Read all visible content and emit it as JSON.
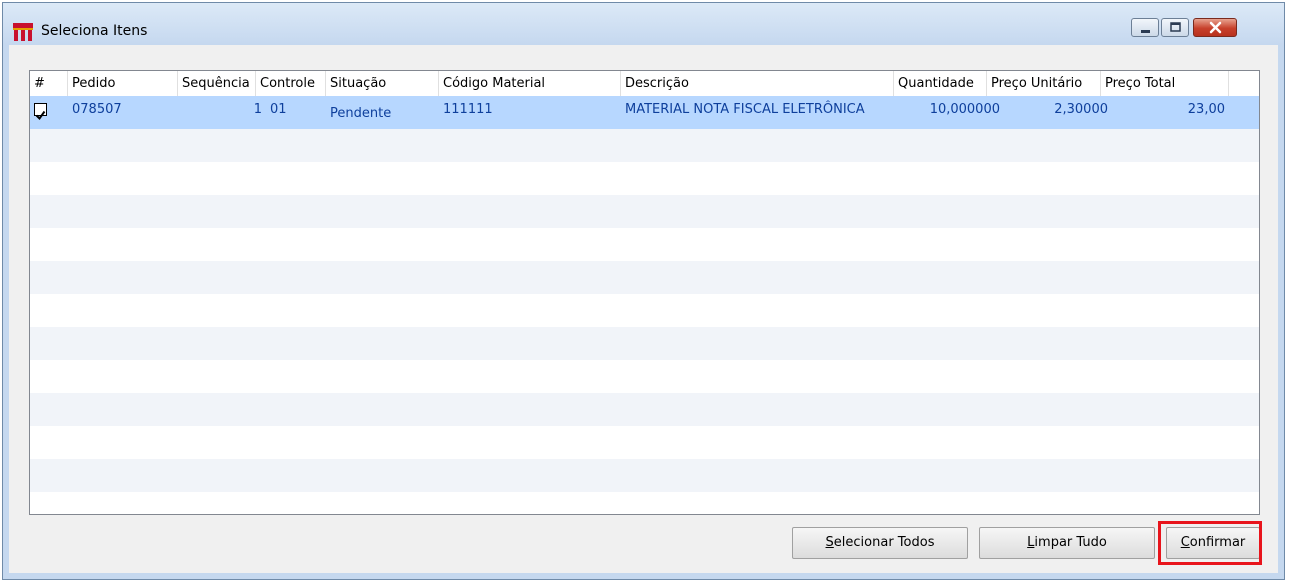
{
  "window": {
    "title": "Seleciona Itens",
    "icon": "app-logo-icon",
    "controls": [
      "minimize-icon",
      "maximize-icon",
      "close-icon"
    ]
  },
  "table": {
    "columns": [
      "#",
      "Pedido",
      "Sequência",
      "Controle",
      "Situação",
      "Código Material",
      "Descrição",
      "Quantidade",
      "Preço Unitário",
      "Preço Total"
    ],
    "rows": [
      {
        "checked": true,
        "pedido": "078507",
        "sequencia": "1",
        "controle": "01",
        "situacao": "Pendente",
        "codigo_material": "111111",
        "descricao": "MATERIAL NOTA FISCAL ELETRÔNICA",
        "quantidade": "10,000000",
        "preco_unitario": "2,30000",
        "preco_total": "23,00"
      }
    ]
  },
  "buttons": {
    "select_all": {
      "accel": "S",
      "rest": "elecionar Todos"
    },
    "clear_all": {
      "accel": "L",
      "rest": "impar Tudo"
    },
    "confirm": {
      "accel": "C",
      "rest": "onfirmar"
    }
  },
  "colors": {
    "selected_row": "#b7d7ff",
    "alt_row": "#f1f4f9",
    "cell_text": "#0e3f9c",
    "highlight_border": "#e8141c"
  }
}
